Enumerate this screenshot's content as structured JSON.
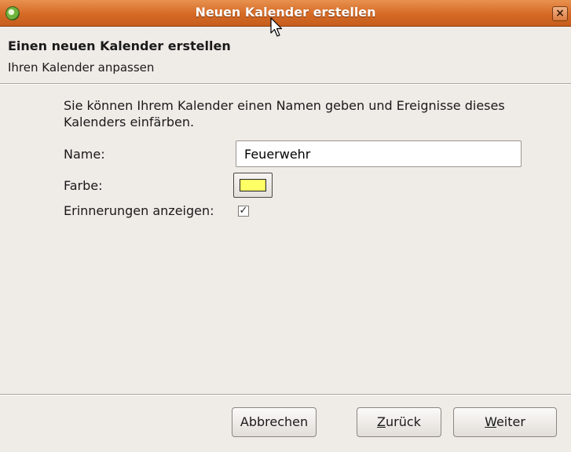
{
  "window": {
    "title": "Neuen Kalender erstellen",
    "close_symbol": "×",
    "icons": {
      "app": "app-icon",
      "close": "close-icon",
      "cursor": "mouse-pointer-icon"
    }
  },
  "header": {
    "title": "Einen neuen Kalender erstellen",
    "subtitle": "Ihren Kalender anpassen"
  },
  "form": {
    "description": "Sie können Ihrem Kalender einen Namen geben und Ereignisse dieses Kalenders einfärben.",
    "name_label": "Name:",
    "name_value": "Feuerwehr",
    "color_label": "Farbe:",
    "color_value": "#ffff66",
    "reminders_label": "Erinnerungen anzeigen:",
    "reminders_checked": true,
    "check_mark": "✓"
  },
  "buttons": {
    "cancel": "Abbrechen",
    "back_mnemonic": "Z",
    "back_rest": "urück",
    "next_mnemonic": "W",
    "next_rest": "eiter"
  }
}
